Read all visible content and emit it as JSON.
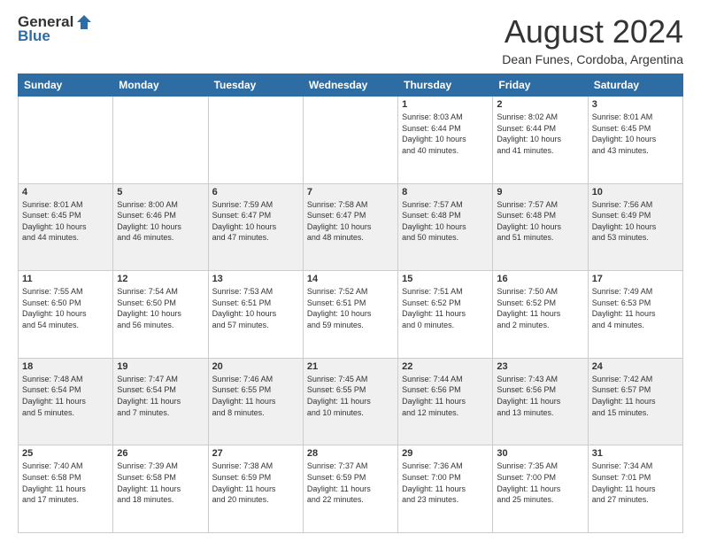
{
  "header": {
    "logo_general": "General",
    "logo_blue": "Blue",
    "month_title": "August 2024",
    "location": "Dean Funes, Cordoba, Argentina"
  },
  "days_of_week": [
    "Sunday",
    "Monday",
    "Tuesday",
    "Wednesday",
    "Thursday",
    "Friday",
    "Saturday"
  ],
  "weeks": [
    {
      "shade": false,
      "days": [
        {
          "number": "",
          "info": ""
        },
        {
          "number": "",
          "info": ""
        },
        {
          "number": "",
          "info": ""
        },
        {
          "number": "",
          "info": ""
        },
        {
          "number": "1",
          "info": "Sunrise: 8:03 AM\nSunset: 6:44 PM\nDaylight: 10 hours\nand 40 minutes."
        },
        {
          "number": "2",
          "info": "Sunrise: 8:02 AM\nSunset: 6:44 PM\nDaylight: 10 hours\nand 41 minutes."
        },
        {
          "number": "3",
          "info": "Sunrise: 8:01 AM\nSunset: 6:45 PM\nDaylight: 10 hours\nand 43 minutes."
        }
      ]
    },
    {
      "shade": true,
      "days": [
        {
          "number": "4",
          "info": "Sunrise: 8:01 AM\nSunset: 6:45 PM\nDaylight: 10 hours\nand 44 minutes."
        },
        {
          "number": "5",
          "info": "Sunrise: 8:00 AM\nSunset: 6:46 PM\nDaylight: 10 hours\nand 46 minutes."
        },
        {
          "number": "6",
          "info": "Sunrise: 7:59 AM\nSunset: 6:47 PM\nDaylight: 10 hours\nand 47 minutes."
        },
        {
          "number": "7",
          "info": "Sunrise: 7:58 AM\nSunset: 6:47 PM\nDaylight: 10 hours\nand 48 minutes."
        },
        {
          "number": "8",
          "info": "Sunrise: 7:57 AM\nSunset: 6:48 PM\nDaylight: 10 hours\nand 50 minutes."
        },
        {
          "number": "9",
          "info": "Sunrise: 7:57 AM\nSunset: 6:48 PM\nDaylight: 10 hours\nand 51 minutes."
        },
        {
          "number": "10",
          "info": "Sunrise: 7:56 AM\nSunset: 6:49 PM\nDaylight: 10 hours\nand 53 minutes."
        }
      ]
    },
    {
      "shade": false,
      "days": [
        {
          "number": "11",
          "info": "Sunrise: 7:55 AM\nSunset: 6:50 PM\nDaylight: 10 hours\nand 54 minutes."
        },
        {
          "number": "12",
          "info": "Sunrise: 7:54 AM\nSunset: 6:50 PM\nDaylight: 10 hours\nand 56 minutes."
        },
        {
          "number": "13",
          "info": "Sunrise: 7:53 AM\nSunset: 6:51 PM\nDaylight: 10 hours\nand 57 minutes."
        },
        {
          "number": "14",
          "info": "Sunrise: 7:52 AM\nSunset: 6:51 PM\nDaylight: 10 hours\nand 59 minutes."
        },
        {
          "number": "15",
          "info": "Sunrise: 7:51 AM\nSunset: 6:52 PM\nDaylight: 11 hours\nand 0 minutes."
        },
        {
          "number": "16",
          "info": "Sunrise: 7:50 AM\nSunset: 6:52 PM\nDaylight: 11 hours\nand 2 minutes."
        },
        {
          "number": "17",
          "info": "Sunrise: 7:49 AM\nSunset: 6:53 PM\nDaylight: 11 hours\nand 4 minutes."
        }
      ]
    },
    {
      "shade": true,
      "days": [
        {
          "number": "18",
          "info": "Sunrise: 7:48 AM\nSunset: 6:54 PM\nDaylight: 11 hours\nand 5 minutes."
        },
        {
          "number": "19",
          "info": "Sunrise: 7:47 AM\nSunset: 6:54 PM\nDaylight: 11 hours\nand 7 minutes."
        },
        {
          "number": "20",
          "info": "Sunrise: 7:46 AM\nSunset: 6:55 PM\nDaylight: 11 hours\nand 8 minutes."
        },
        {
          "number": "21",
          "info": "Sunrise: 7:45 AM\nSunset: 6:55 PM\nDaylight: 11 hours\nand 10 minutes."
        },
        {
          "number": "22",
          "info": "Sunrise: 7:44 AM\nSunset: 6:56 PM\nDaylight: 11 hours\nand 12 minutes."
        },
        {
          "number": "23",
          "info": "Sunrise: 7:43 AM\nSunset: 6:56 PM\nDaylight: 11 hours\nand 13 minutes."
        },
        {
          "number": "24",
          "info": "Sunrise: 7:42 AM\nSunset: 6:57 PM\nDaylight: 11 hours\nand 15 minutes."
        }
      ]
    },
    {
      "shade": false,
      "days": [
        {
          "number": "25",
          "info": "Sunrise: 7:40 AM\nSunset: 6:58 PM\nDaylight: 11 hours\nand 17 minutes."
        },
        {
          "number": "26",
          "info": "Sunrise: 7:39 AM\nSunset: 6:58 PM\nDaylight: 11 hours\nand 18 minutes."
        },
        {
          "number": "27",
          "info": "Sunrise: 7:38 AM\nSunset: 6:59 PM\nDaylight: 11 hours\nand 20 minutes."
        },
        {
          "number": "28",
          "info": "Sunrise: 7:37 AM\nSunset: 6:59 PM\nDaylight: 11 hours\nand 22 minutes."
        },
        {
          "number": "29",
          "info": "Sunrise: 7:36 AM\nSunset: 7:00 PM\nDaylight: 11 hours\nand 23 minutes."
        },
        {
          "number": "30",
          "info": "Sunrise: 7:35 AM\nSunset: 7:00 PM\nDaylight: 11 hours\nand 25 minutes."
        },
        {
          "number": "31",
          "info": "Sunrise: 7:34 AM\nSunset: 7:01 PM\nDaylight: 11 hours\nand 27 minutes."
        }
      ]
    }
  ]
}
